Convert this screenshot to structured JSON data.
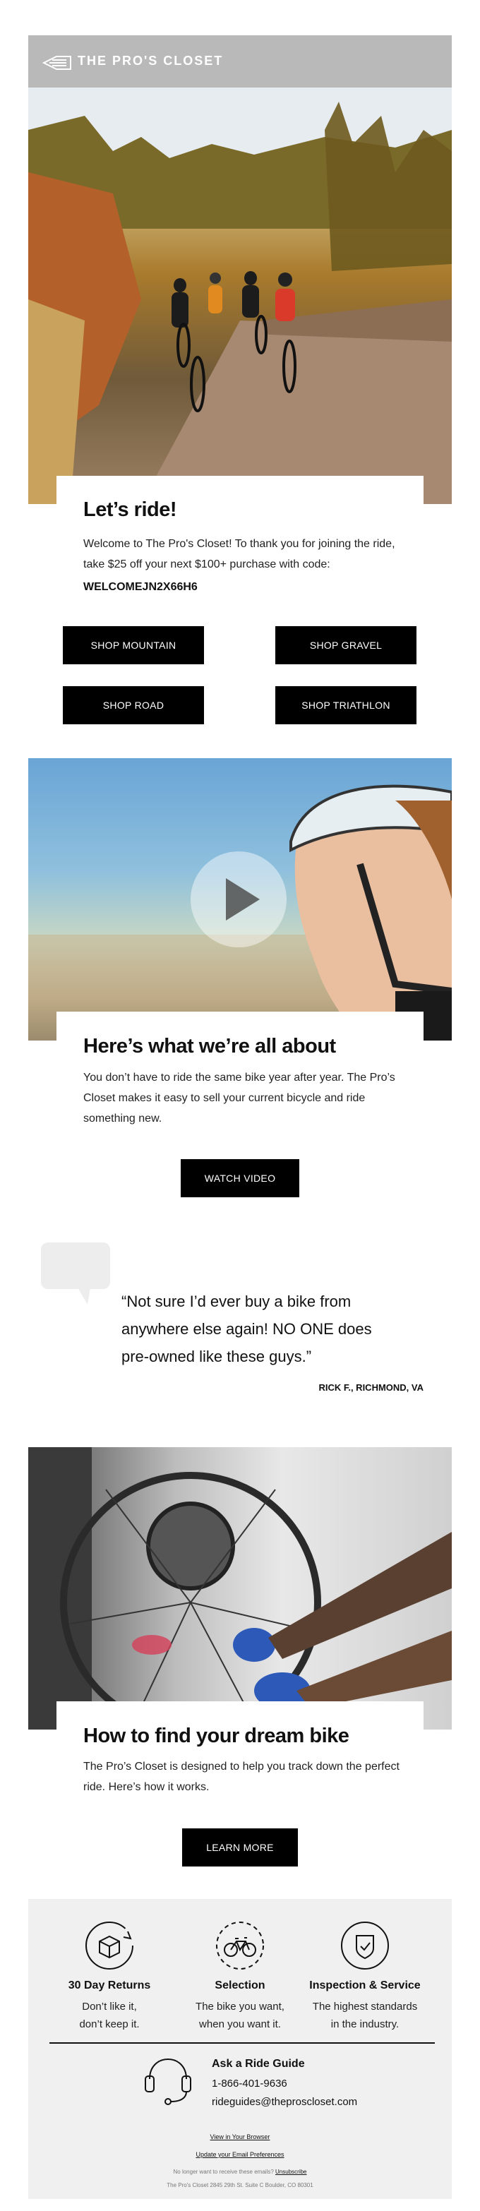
{
  "brand": {
    "logo_text": "THE PRO'S CLOSET"
  },
  "welcome": {
    "heading": "Let’s ride!",
    "body": "Welcome to The Pro's Closet! To thank you for joining the ride, take $25 off your next $100+ purchase with code:",
    "code": "WELCOMEJN2X66H6"
  },
  "shop": {
    "mountain": "SHOP MOUNTAIN",
    "gravel": "SHOP GRAVEL",
    "road": "SHOP ROAD",
    "triathlon": "SHOP TRIATHLON"
  },
  "about": {
    "heading": "Here’s what we’re all about",
    "body": "You don’t have to ride the same bike year after year. The Pro’s Closet makes it easy to sell your current bicycle and ride something new.",
    "button": "WATCH VIDEO"
  },
  "testimonial": {
    "quote": "“Not sure I’d ever buy a bike from anywhere else again! NO ONE does pre-owned like these guys.”",
    "author": "RICK F., RICHMOND, VA"
  },
  "dream": {
    "heading": "How to find your dream bike",
    "body": "The Pro’s Closet is designed to help you track down the perfect ride. Here’s how it works.",
    "button": "LEARN MORE"
  },
  "features": [
    {
      "title": "30 Day Returns",
      "desc1": "Don’t like it,",
      "desc2": "don’t keep it.",
      "icon": "return-box-icon"
    },
    {
      "title": "Selection",
      "desc1": "The bike you want,",
      "desc2": "when you want it.",
      "icon": "bicycle-icon"
    },
    {
      "title": "Inspection & Service",
      "desc1": "The highest standards",
      "desc2": "in the industry.",
      "icon": "shield-check-icon"
    }
  ],
  "guide": {
    "title": "Ask a Ride Guide",
    "phone": "1-866-401-9636",
    "email": "rideguides@theproscloset.com"
  },
  "footer": {
    "view_browser": "View in Your Browser",
    "update_prefs": "Update your Email Preferences",
    "unsubscribe_prefix": "No longer want to receive these emails?",
    "unsubscribe": "Unsubscribe",
    "address": "The Pro's Closet 2845 29th St. Suite C Boulder, CO 80301"
  },
  "colors": {
    "button_bg": "#000000",
    "footer_bg": "#f0f0f0",
    "header_bg": "#b9b9b9"
  }
}
